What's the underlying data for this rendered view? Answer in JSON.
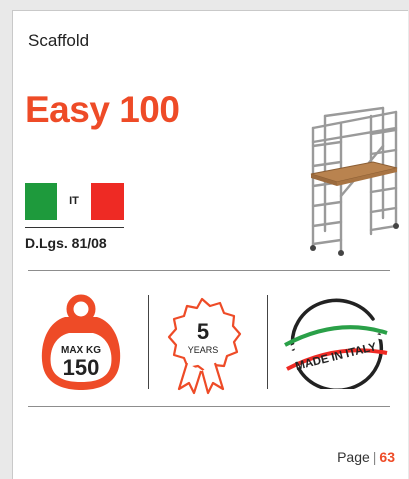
{
  "header": {
    "category": "Scaffold"
  },
  "product": {
    "name": "Easy 100"
  },
  "flag": {
    "country_code": "IT",
    "green": "#1e9a3c",
    "red": "#ee2a24"
  },
  "norm": "D.Lgs. 81/08",
  "badges": {
    "weight": {
      "label": "MAX KG",
      "value": "150"
    },
    "warranty": {
      "value": "5",
      "label": "YEARS"
    },
    "origin": {
      "label": "MADE IN ITALY"
    }
  },
  "footer": {
    "label": "Page",
    "separator": "|",
    "number": "63"
  },
  "colors": {
    "accent": "#ee4b27",
    "text": "#222222",
    "background": "#e9e9e9"
  },
  "icons": [
    "scaffold-image",
    "weight-icon",
    "warranty-rosette-icon",
    "made-in-italy-seal-icon"
  ]
}
